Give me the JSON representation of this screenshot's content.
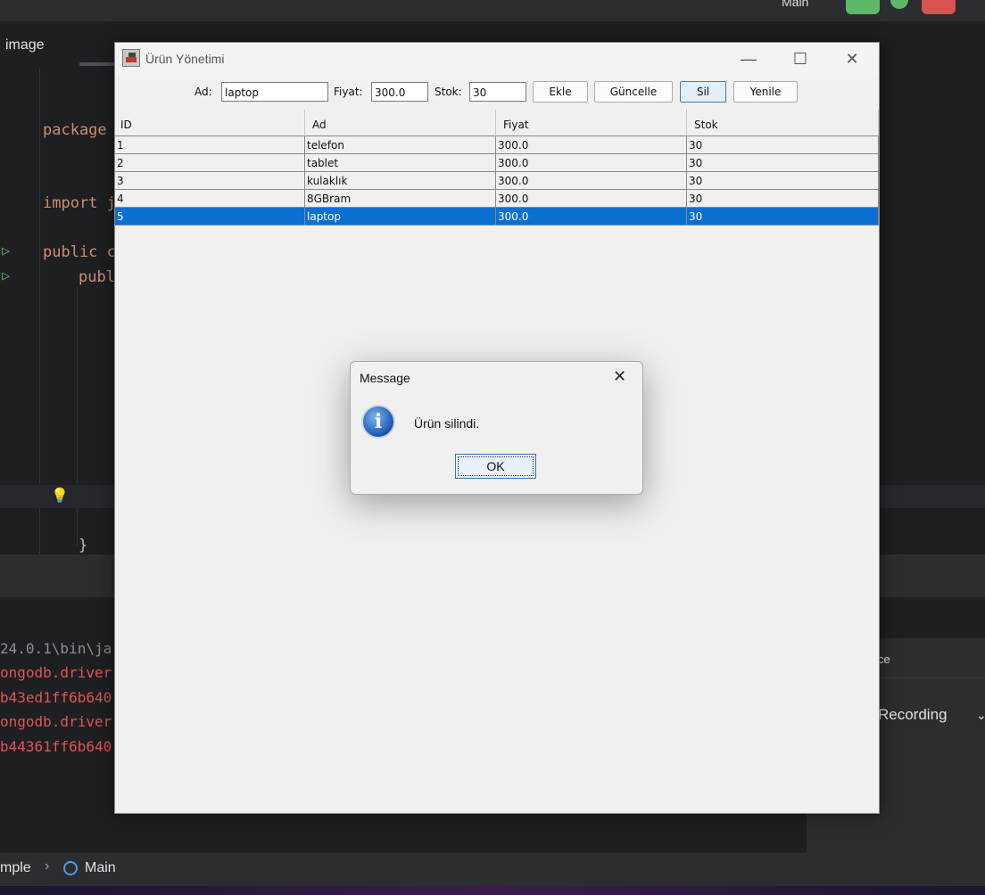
{
  "ide": {
    "run_config": "Main",
    "tab_image": "image",
    "code": {
      "line_package": "package",
      "line_import": "import j",
      "line_public_class": "public c",
      "line_public_method": "publ",
      "closing_brace": "}"
    },
    "console": {
      "line1": "24.0.1\\bin\\ja",
      "line2": "ongodb.driver",
      "line3": "b43ed1ff6b640",
      "line4": "ongodb.driver",
      "line5": "b44361ff6b640"
    },
    "right_panel": {
      "item1": "ce",
      "recording": "Recording"
    },
    "breadcrumb": {
      "project": "mple",
      "file": "Main"
    }
  },
  "app": {
    "title": "Ürün Yönetimi",
    "form": {
      "ad_label": "Ad:",
      "ad_value": "laptop",
      "fiyat_label": "Fiyat:",
      "fiyat_value": "300.0",
      "stok_label": "Stok:",
      "stok_value": "30"
    },
    "buttons": {
      "ekle": "Ekle",
      "guncelle": "Güncelle",
      "sil": "Sil",
      "yenile": "Yenile"
    },
    "table": {
      "columns": [
        "ID",
        "Ad",
        "Fiyat",
        "Stok"
      ],
      "rows": [
        [
          "1",
          "telefon",
          "300.0",
          "30"
        ],
        [
          "2",
          "tablet",
          "300.0",
          "30"
        ],
        [
          "3",
          "kulaklık",
          "300.0",
          "30"
        ],
        [
          "4",
          "8GBram",
          "300.0",
          "30"
        ],
        [
          "5",
          "laptop",
          "300.0",
          "30"
        ]
      ],
      "selected_row": 4
    }
  },
  "dialog": {
    "title": "Message",
    "message": "Ürün silindi.",
    "ok_label": "OK",
    "icon": "info-icon"
  },
  "colors": {
    "selection": "#0a6fd1",
    "ide_bg": "#1e1f22",
    "keyword": "#cf8e6d",
    "console_error": "#e05555"
  }
}
